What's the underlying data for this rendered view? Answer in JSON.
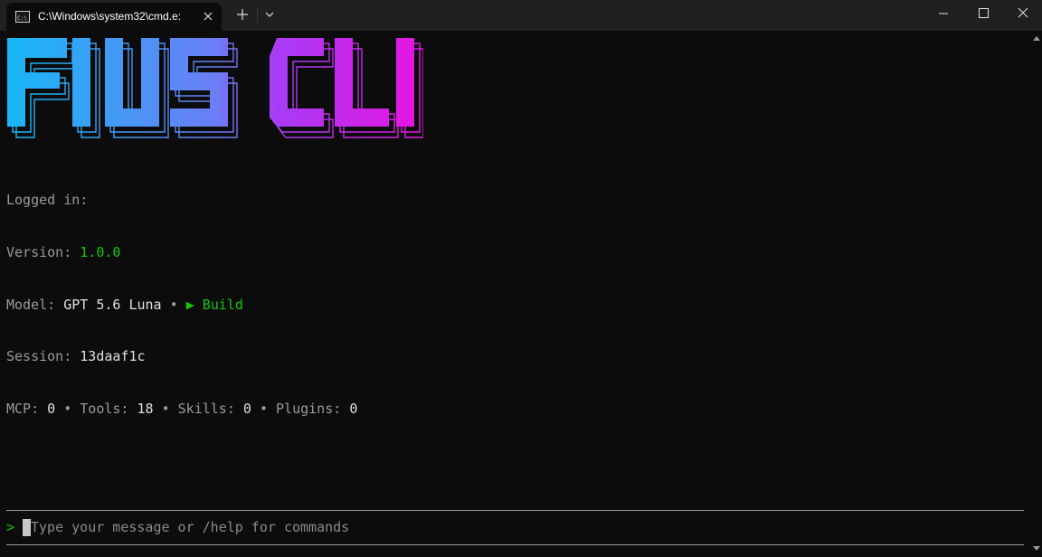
{
  "window": {
    "tab_title": "C:\\Windows\\system32\\cmd.e:",
    "tab_icon": "console-icon",
    "controls": [
      "minimize-icon",
      "maximize-icon",
      "close-icon"
    ]
  },
  "banner": {
    "text": "FIUS CLI",
    "gradient": [
      "#1ab4f5",
      "#5a8af5",
      "#a03cf5",
      "#e61ae6"
    ]
  },
  "info": {
    "logged_in_label": "Logged in:",
    "version_label": "Version:",
    "version_value": "1.0.0",
    "model_label": "Model:",
    "model_value": "GPT 5.6 Luna",
    "separator": "•",
    "mode_value": "▶ Build",
    "session_label": "Session:",
    "session_value": "13daaf1c",
    "mcp_label": "MCP:",
    "mcp_value": "0",
    "tools_label": "Tools:",
    "tools_value": "18",
    "skills_label": "Skills:",
    "skills_value": "0",
    "plugins_label": "Plugins:",
    "plugins_value": "0"
  },
  "input": {
    "prompt": ">",
    "placeholder": "Type your message or /help for commands"
  },
  "colors": {
    "background": "#0c0c0c",
    "accent_green": "#16c60c",
    "muted": "#9a9a9a"
  }
}
